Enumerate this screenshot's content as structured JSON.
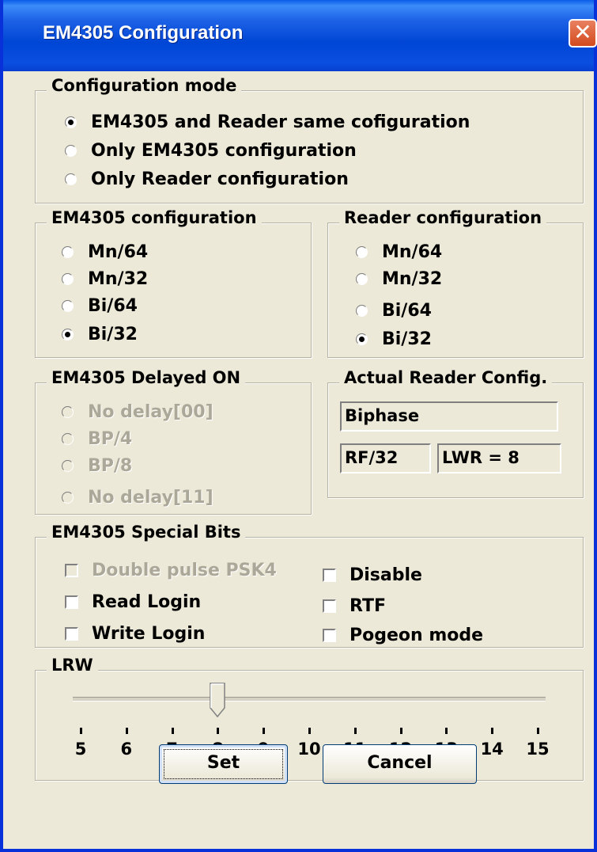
{
  "window": {
    "title": "EM4305 Configuration",
    "close_glyph": "✕"
  },
  "config_mode": {
    "legend": "Configuration mode",
    "options": [
      {
        "label": "EM4305 and Reader same cofiguration",
        "checked": true
      },
      {
        "label": "Only EM4305 configuration",
        "checked": false
      },
      {
        "label": "Only Reader configuration",
        "checked": false
      }
    ]
  },
  "em4305_config": {
    "legend": "EM4305 configuration",
    "options": [
      {
        "label": "Mn/64",
        "checked": false
      },
      {
        "label": "Mn/32",
        "checked": false
      },
      {
        "label": "Bi/64",
        "checked": false
      },
      {
        "label": "Bi/32",
        "checked": true
      }
    ]
  },
  "reader_config": {
    "legend": "Reader configuration",
    "options": [
      {
        "label": "Mn/64",
        "checked": false
      },
      {
        "label": "Mn/32",
        "checked": false
      },
      {
        "label": "Bi/64",
        "checked": false
      },
      {
        "label": "Bi/32",
        "checked": true
      }
    ]
  },
  "delayed_on": {
    "legend": "EM4305 Delayed ON",
    "options": [
      {
        "label": "No delay[00]",
        "disabled": true
      },
      {
        "label": "BP/4",
        "disabled": true
      },
      {
        "label": "BP/8",
        "disabled": true
      },
      {
        "label": "No delay[11]",
        "disabled": true
      }
    ]
  },
  "actual_reader": {
    "legend": "Actual Reader Config.",
    "encoding": "Biphase",
    "rf": "RF/32",
    "lwr": "LWR = 8"
  },
  "special_bits": {
    "legend": "EM4305 Special Bits",
    "left": [
      {
        "label": "Double pulse PSK4",
        "disabled": true,
        "checked": false
      },
      {
        "label": "Read Login",
        "disabled": false,
        "checked": false
      },
      {
        "label": "Write Login",
        "disabled": false,
        "checked": false
      }
    ],
    "right": [
      {
        "label": "Disable",
        "checked": false
      },
      {
        "label": "RTF",
        "checked": false
      },
      {
        "label": "Pogeon mode",
        "checked": false
      }
    ]
  },
  "lrw": {
    "legend": "LRW",
    "value": 8,
    "min": 5,
    "max": 15,
    "tick_labels": [
      "5",
      "6",
      "7",
      "8",
      "9",
      "10",
      "11",
      "12",
      "13",
      "14",
      "15"
    ]
  },
  "buttons": {
    "set": "Set",
    "cancel": "Cancel"
  },
  "colors": {
    "titlebar": "#0046d5",
    "dialog_bg": "#ece9d8",
    "disabled_text": "#aca899"
  }
}
